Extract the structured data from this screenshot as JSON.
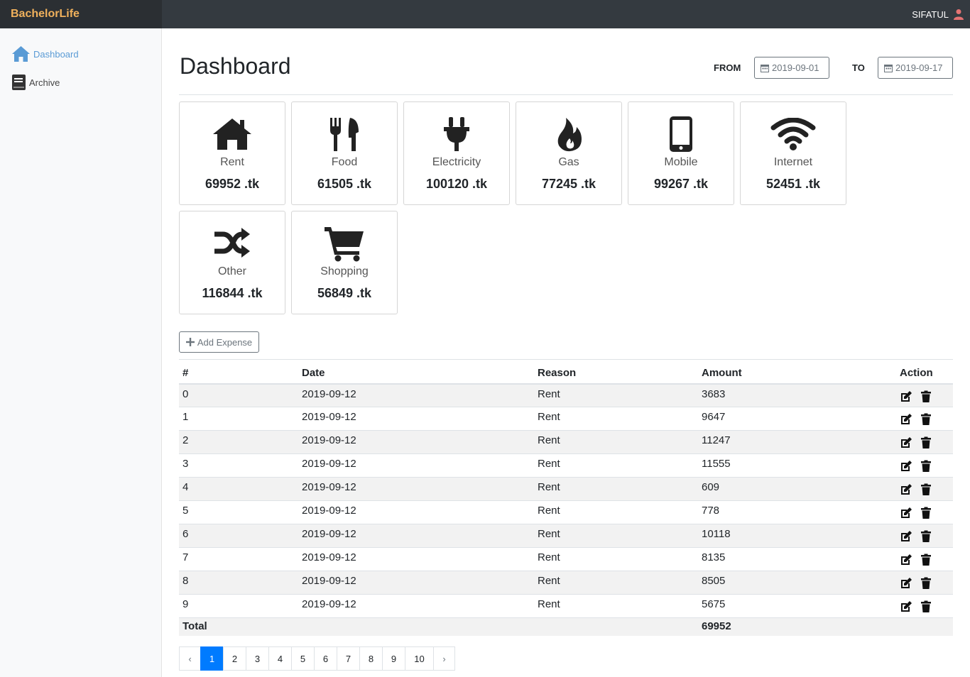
{
  "app": {
    "brand": "BachelorLife",
    "user": "SIFATUL"
  },
  "sidebar": {
    "items": [
      {
        "label": "Dashboard",
        "icon": "home-icon"
      },
      {
        "label": "Archive",
        "icon": "book-icon"
      }
    ]
  },
  "header": {
    "title": "Dashboard",
    "from_label": "FROM",
    "from_date": "2019-09-01",
    "to_label": "TO",
    "to_date": "2019-09-17"
  },
  "cards": [
    {
      "label": "Rent",
      "amount": "69952 .tk",
      "icon": "home-icon"
    },
    {
      "label": "Food",
      "amount": "61505 .tk",
      "icon": "utensils-icon"
    },
    {
      "label": "Electricity",
      "amount": "100120 .tk",
      "icon": "plug-icon"
    },
    {
      "label": "Gas",
      "amount": "77245 .tk",
      "icon": "fire-icon"
    },
    {
      "label": "Mobile",
      "amount": "99267 .tk",
      "icon": "mobile-icon"
    },
    {
      "label": "Internet",
      "amount": "52451 .tk",
      "icon": "wifi-icon"
    },
    {
      "label": "Other",
      "amount": "116844 .tk",
      "icon": "random-icon"
    },
    {
      "label": "Shopping",
      "amount": "56849 .tk",
      "icon": "cart-icon"
    }
  ],
  "add_expense_label": "Add Expense",
  "table": {
    "headers": {
      "num": "#",
      "date": "Date",
      "reason": "Reason",
      "amount": "Amount",
      "action": "Action"
    },
    "rows": [
      [
        "0",
        "2019-09-12",
        "Rent",
        "3683"
      ],
      [
        "1",
        "2019-09-12",
        "Rent",
        "9647"
      ],
      [
        "2",
        "2019-09-12",
        "Rent",
        "11247"
      ],
      [
        "3",
        "2019-09-12",
        "Rent",
        "11555"
      ],
      [
        "4",
        "2019-09-12",
        "Rent",
        "609"
      ],
      [
        "5",
        "2019-09-12",
        "Rent",
        "778"
      ],
      [
        "6",
        "2019-09-12",
        "Rent",
        "10118"
      ],
      [
        "7",
        "2019-09-12",
        "Rent",
        "8135"
      ],
      [
        "8",
        "2019-09-12",
        "Rent",
        "8505"
      ],
      [
        "9",
        "2019-09-12",
        "Rent",
        "5675"
      ]
    ],
    "total_label": "Total",
    "total_amount": "69952"
  },
  "pagination": {
    "prev": "‹",
    "next": "›",
    "pages": [
      "1",
      "2",
      "3",
      "4",
      "5",
      "6",
      "7",
      "8",
      "9",
      "10"
    ],
    "active": "1"
  },
  "colors": {
    "navbar": "#343a40",
    "brand": "#f0b15c",
    "accent": "#007bff",
    "sidebar_active": "#5a9bd5",
    "user_icon": "#e57373"
  }
}
